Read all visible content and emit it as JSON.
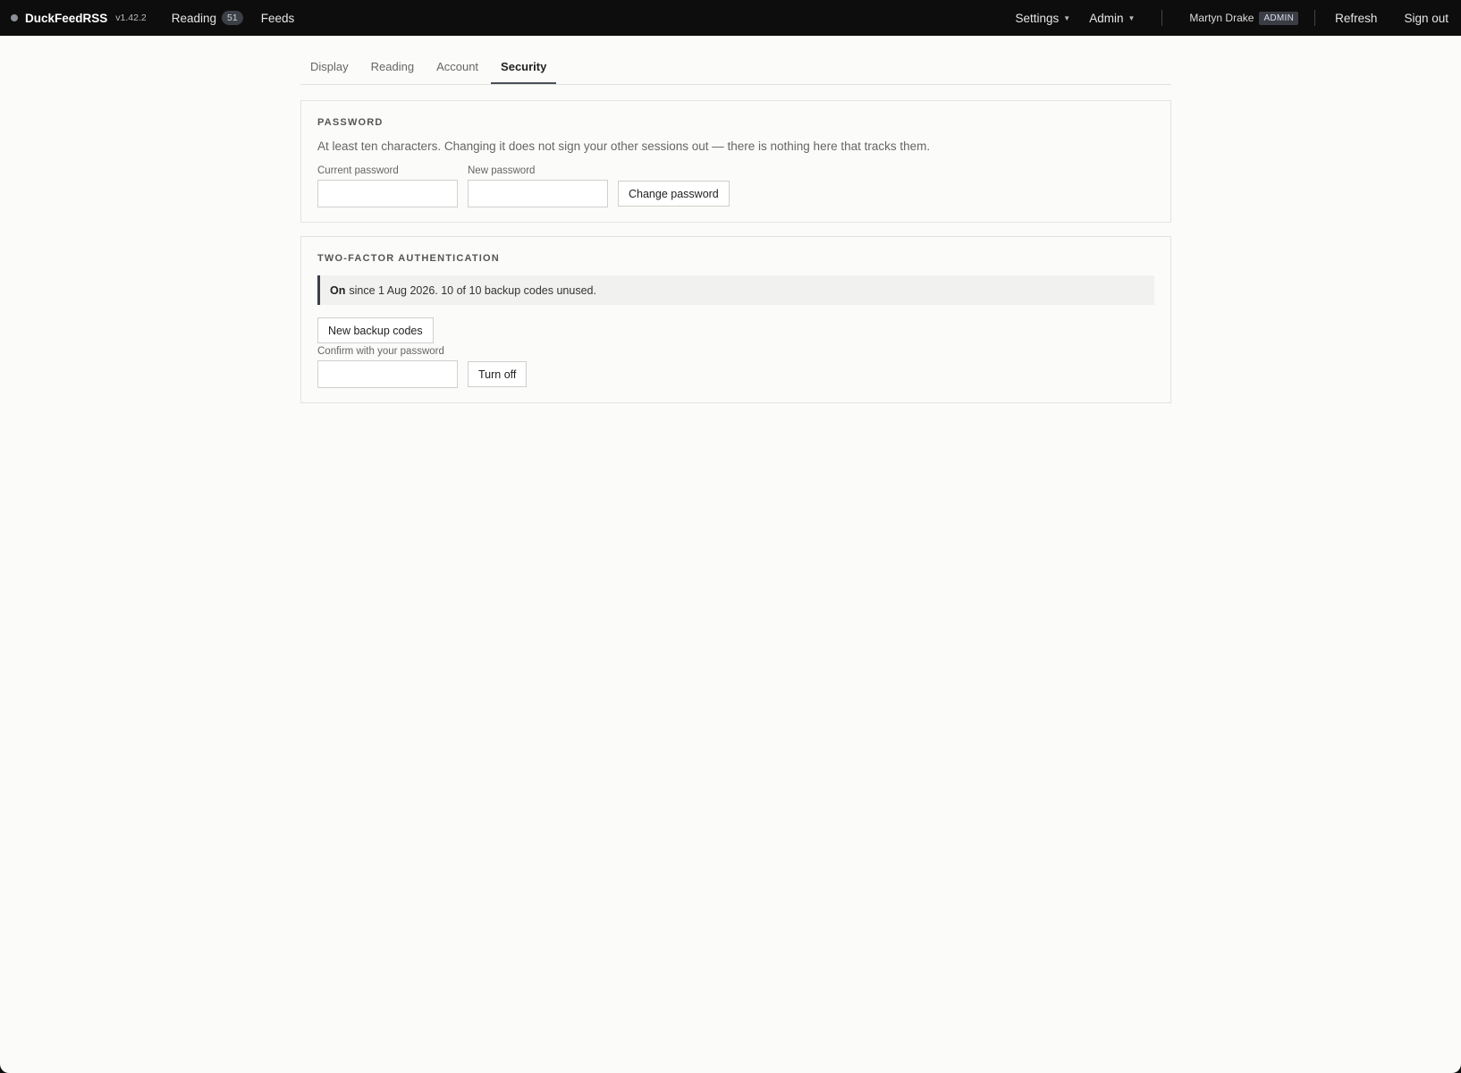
{
  "topbar": {
    "brand": "DuckFeedRSS",
    "version": "v1.42.2",
    "nav": [
      {
        "label": "Reading",
        "badge": "51"
      },
      {
        "label": "Feeds"
      }
    ],
    "menus": [
      {
        "label": "Settings"
      },
      {
        "label": "Admin"
      }
    ],
    "user": {
      "name": "Martyn Drake",
      "role": "ADMIN"
    },
    "actions": {
      "refresh": "Refresh",
      "sign_out": "Sign out"
    }
  },
  "tabs": [
    {
      "label": "Display",
      "active": false
    },
    {
      "label": "Reading",
      "active": false
    },
    {
      "label": "Account",
      "active": false
    },
    {
      "label": "Security",
      "active": true
    }
  ],
  "password": {
    "title": "PASSWORD",
    "description": "At least ten characters. Changing it does not sign your other sessions out — there is nothing here that tracks them.",
    "current_label": "Current password",
    "current_value": "",
    "new_label": "New password",
    "new_value": "",
    "submit": "Change password"
  },
  "two_factor": {
    "title": "TWO-FACTOR AUTHENTICATION",
    "status_strong": "On",
    "status_text": "since 1 Aug 2026. 10 of 10 backup codes unused.",
    "backup_button": "New backup codes",
    "confirm_label": "Confirm with your password",
    "confirm_value": "",
    "turn_off": "Turn off"
  },
  "colors": {
    "topbar_bg": "#0d0d0d",
    "page_bg": "#fbfbf9",
    "accent": "#3c4048"
  }
}
